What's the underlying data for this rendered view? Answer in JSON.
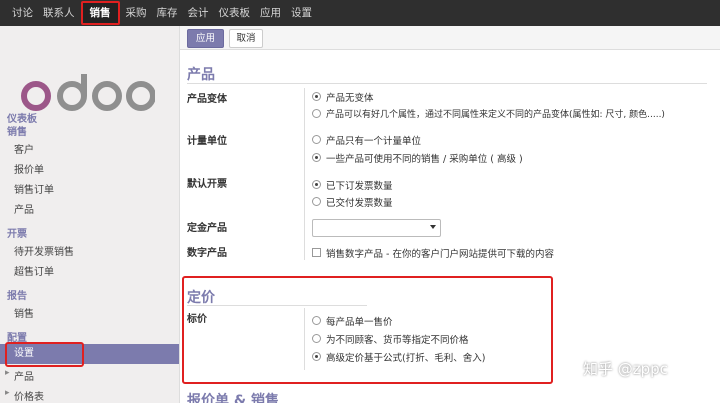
{
  "topnav": {
    "items": [
      "讨论",
      "联系人",
      "销售",
      "采购",
      "库存",
      "会计",
      "仪表板",
      "应用",
      "设置"
    ],
    "active": "销售"
  },
  "sidebar": {
    "logo_text": "odoo",
    "groups": [
      {
        "header": "仪表板"
      },
      {
        "header": "销售",
        "items": [
          "客户",
          "报价单",
          "销售订单",
          "产品"
        ]
      },
      {
        "header": "开票",
        "items": [
          "待开发票销售",
          "超售订单"
        ]
      },
      {
        "header": "报告",
        "items": [
          "销售"
        ]
      },
      {
        "header": "配置",
        "items": [
          "设置",
          "产品",
          "价格表"
        ]
      }
    ],
    "active_item": "设置"
  },
  "toolbar": {
    "apply_label": "应用",
    "cancel_label": "取消"
  },
  "products_section": {
    "title": "产品",
    "variants": {
      "label": "产品变体",
      "options": [
        "产品无变体",
        "产品可以有好几个属性，通过不同属性来定义不同的产品变体(属性如: 尺寸, 颜色.....)"
      ],
      "selected": 0
    },
    "uom": {
      "label": "计量单位",
      "options": [
        "产品只有一个计量单位",
        "一些产品可使用不同的销售 / 采购单位 ( 高级 )"
      ],
      "selected": 1
    },
    "invoicing": {
      "label": "默认开票",
      "options": [
        "已下订发票数量",
        "已交付发票数量"
      ],
      "selected": 0
    },
    "deposit": {
      "label": "定金产品",
      "value": ""
    },
    "digital": {
      "label": "数字产品",
      "checkbox_label": "销售数字产品 - 在你的客户门户网站提供可下载的内容",
      "checked": false
    }
  },
  "pricing_section": {
    "title": "定价",
    "label": "标价",
    "options": [
      "每产品单一售价",
      "为不同顾客、货币等指定不同价格",
      "高级定价基于公式(打折、毛利、舍入)"
    ],
    "selected": 2
  },
  "next_section": {
    "title": "报价单 & 销售"
  },
  "watermark": "知乎 @zppc",
  "colors": {
    "accent": "#7c7bad",
    "highlight": "#e02020",
    "topbar": "#2f2f2f"
  }
}
